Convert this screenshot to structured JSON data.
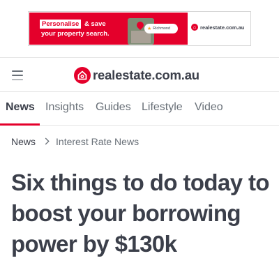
{
  "ad": {
    "highlight": "Personalise",
    "tail": "& save",
    "line2": "your property search.",
    "pill_label": "Richmond",
    "brand": "realestate.com.au"
  },
  "header": {
    "brand": "realestate.com.au"
  },
  "nav": {
    "tabs": [
      "News",
      "Insights",
      "Guides",
      "Lifestyle",
      "Video"
    ],
    "active": "News"
  },
  "breadcrumb": {
    "items": [
      "News",
      "Interest Rate News"
    ]
  },
  "article": {
    "title": "Six things to do today to boost your borrowing power by $130k"
  },
  "colors": {
    "accent": "#e4002b",
    "text": "#3b3f4a",
    "muted": "#697078"
  }
}
